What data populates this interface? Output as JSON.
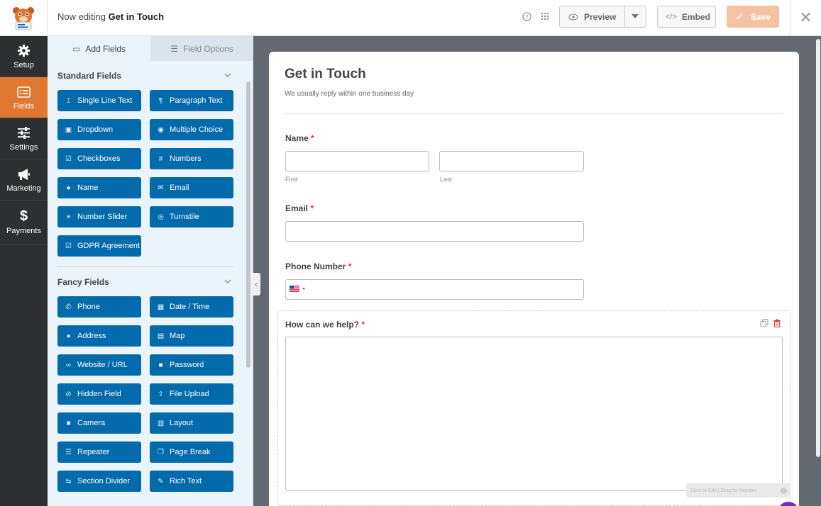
{
  "header": {
    "editing_prefix": "Now editing",
    "form_name": "Get in Touch",
    "preview_label": "Preview",
    "embed_label": "Embed",
    "save_label": "Save"
  },
  "nav": {
    "items": [
      {
        "label": "Setup",
        "icon": "gear-icon",
        "active": false
      },
      {
        "label": "Fields",
        "icon": "list-icon",
        "active": true
      },
      {
        "label": "Settings",
        "icon": "sliders-icon",
        "active": false
      },
      {
        "label": "Marketing",
        "icon": "megaphone-icon",
        "active": false
      },
      {
        "label": "Payments",
        "icon": "dollar-icon",
        "active": false
      }
    ]
  },
  "panel": {
    "tabs": [
      {
        "label": "Add Fields",
        "active": true
      },
      {
        "label": "Field Options",
        "active": false
      }
    ],
    "standard_title": "Standard Fields",
    "fancy_title": "Fancy Fields",
    "standard_fields": [
      {
        "label": "Single Line Text",
        "icon": "text-icon"
      },
      {
        "label": "Paragraph Text",
        "icon": "paragraph-icon"
      },
      {
        "label": "Dropdown",
        "icon": "dropdown-icon"
      },
      {
        "label": "Multiple Choice",
        "icon": "radio-icon"
      },
      {
        "label": "Checkboxes",
        "icon": "checkbox-icon"
      },
      {
        "label": "Numbers",
        "icon": "hash-icon"
      },
      {
        "label": "Name",
        "icon": "user-icon"
      },
      {
        "label": "Email",
        "icon": "envelope-icon"
      },
      {
        "label": "Number Slider",
        "icon": "slider-icon"
      },
      {
        "label": "Turnstile",
        "icon": "turnstile-icon"
      },
      {
        "label": "GDPR Agreement",
        "icon": "checkbox-icon"
      }
    ],
    "fancy_fields": [
      {
        "label": "Phone",
        "icon": "phone-icon"
      },
      {
        "label": "Date / Time",
        "icon": "calendar-icon"
      },
      {
        "label": "Address",
        "icon": "pin-icon"
      },
      {
        "label": "Map",
        "icon": "map-icon"
      },
      {
        "label": "Website / URL",
        "icon": "link-icon"
      },
      {
        "label": "Password",
        "icon": "lock-icon"
      },
      {
        "label": "Hidden Field",
        "icon": "eye-slash-icon"
      },
      {
        "label": "File Upload",
        "icon": "upload-icon"
      },
      {
        "label": "Camera",
        "icon": "camera-icon"
      },
      {
        "label": "Layout",
        "icon": "layout-icon"
      },
      {
        "label": "Repeater",
        "icon": "repeater-icon"
      },
      {
        "label": "Page Break",
        "icon": "copy-icon"
      },
      {
        "label": "Section Divider",
        "icon": "divider-icon"
      },
      {
        "label": "Rich Text",
        "icon": "edit-icon"
      }
    ]
  },
  "form": {
    "title": "Get in Touch",
    "description": "We usually reply within one business day",
    "name_label": "Name",
    "first_sub": "First",
    "last_sub": "Last",
    "email_label": "Email",
    "phone_label": "Phone Number",
    "help_label": "How can we help?",
    "required_mark": "*",
    "drag_hint": "Click to Edit | Drag to Reorder"
  },
  "colors": {
    "accent": "#e27730",
    "field_button": "#036aab",
    "save": "#f6c2a4",
    "nav_bg": "#2d2f31"
  }
}
